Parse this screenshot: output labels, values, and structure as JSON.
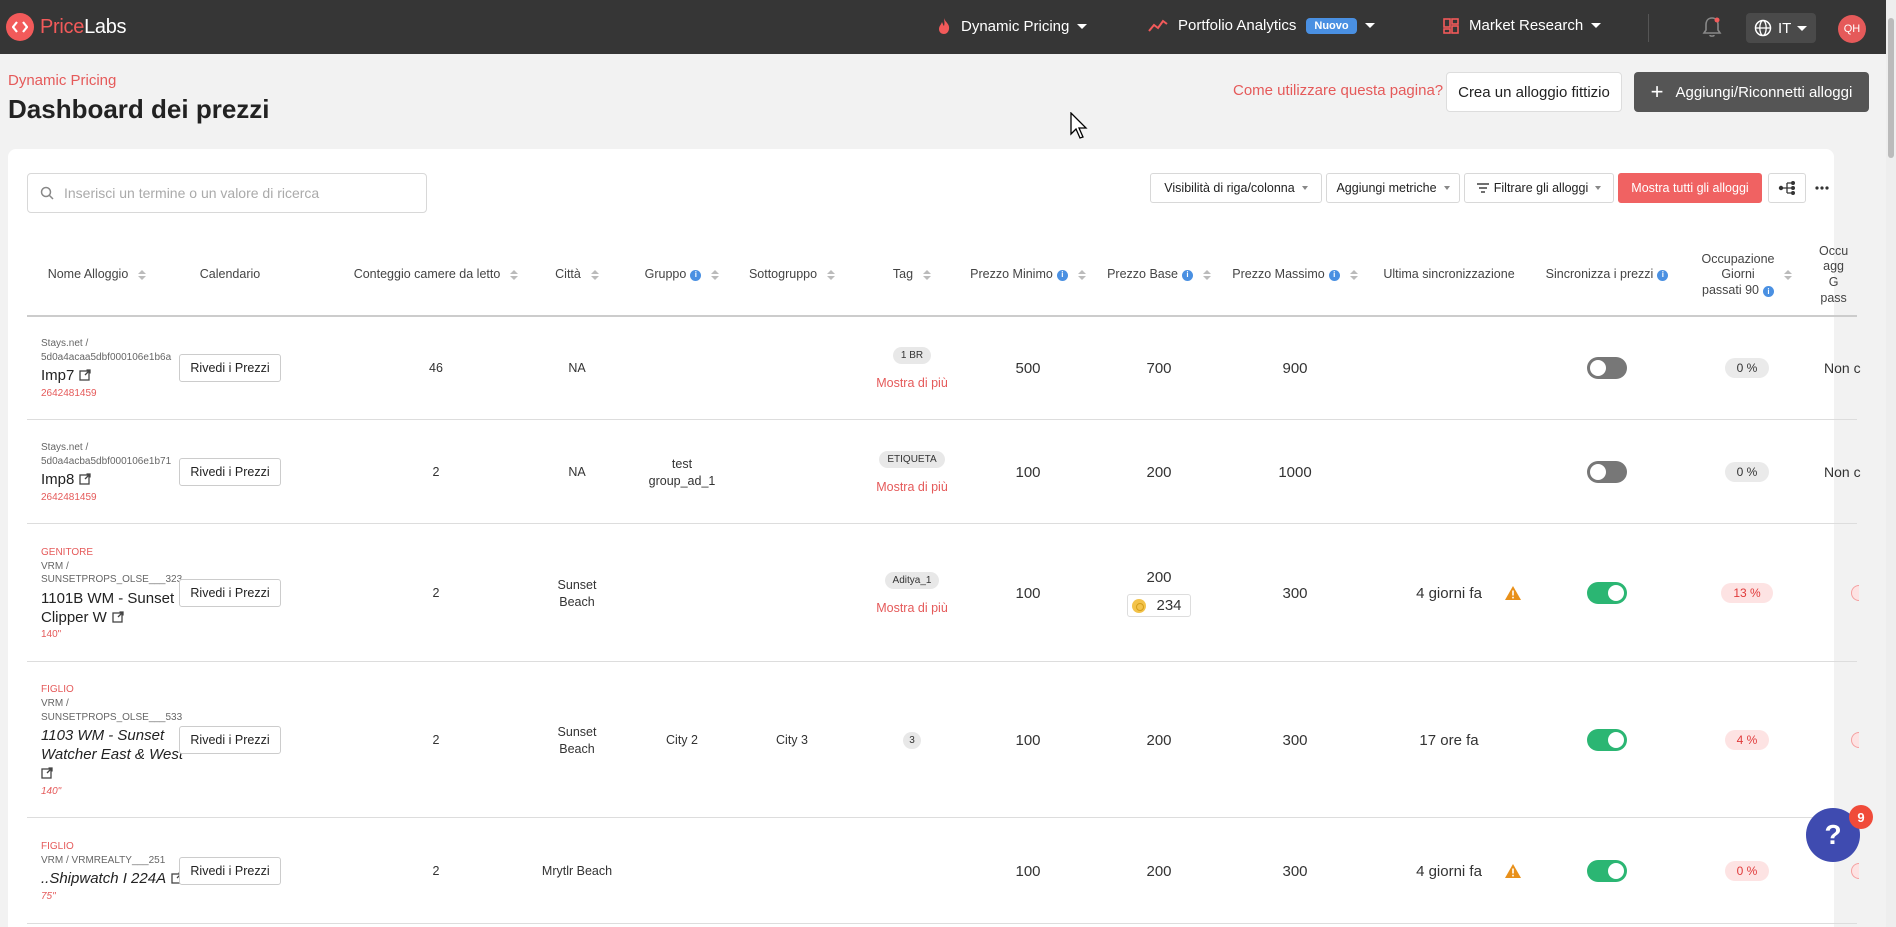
{
  "nav": {
    "logo_part1": "Price",
    "logo_part2": "Labs",
    "dynamic_pricing": "Dynamic Pricing",
    "portfolio_analytics": "Portfolio Analytics",
    "nuovo_badge": "Nuovo",
    "market_research": "Market Research",
    "language": "IT",
    "avatar_initials": "QH"
  },
  "header": {
    "breadcrumb": "Dynamic Pricing",
    "title": "Dashboard dei prezzi",
    "help_link": "Come utilizzare questa pagina?",
    "create_dummy_button": "Crea un alloggio fittizio",
    "add_reconnect_button": "Aggiungi/Riconnetti alloggi"
  },
  "toolbar": {
    "search_placeholder": "Inserisci un termine o un valore di ricerca",
    "visibility_button": "Visibilità di riga/colonna",
    "add_metrics_button": "Aggiungi metriche",
    "filter_button": "Filtrare gli alloggi",
    "show_all_button": "Mostra tutti gli alloggi"
  },
  "columns": {
    "name": "Nome Alloggio",
    "calendar": "Calendario",
    "bedrooms": "Conteggio camere da letto",
    "city": "Città",
    "group": "Gruppo",
    "subgroup": "Sottogruppo",
    "tag": "Tag",
    "min_price": "Prezzo Minimo",
    "base_price": "Prezzo Base",
    "max_price": "Prezzo Massimo",
    "last_sync": "Ultima sincronizzazione",
    "sync_prices": "Sincronizza i prezzi",
    "occupancy_l1": "Occupazione",
    "occupancy_l2": "Giorni",
    "occupancy_l3": "passati 90",
    "cut_l1": "Occu",
    "cut_l2": "agg",
    "cut_l3": "G",
    "cut_l4": "pass"
  },
  "common": {
    "review_button": "Rivedi i Prezzi",
    "show_more": "Mostra di più",
    "non_cut": "Non c"
  },
  "rows": [
    {
      "relation": "",
      "pms_line1": "Stays.net /",
      "pms_line2": "5d0a4acaa5dbf000106e1b6a",
      "name": "Imp7",
      "listing_id": "2642481459",
      "bedrooms": "46",
      "city": "NA",
      "group": "",
      "subgroup": "",
      "tag": "1 BR",
      "min_price": "500",
      "base_price": "700",
      "base_alt": "",
      "max_price": "900",
      "last_sync": "",
      "sync_on": false,
      "occupancy": "0 %"
    },
    {
      "relation": "",
      "pms_line1": "Stays.net /",
      "pms_line2": "5d0a4acba5dbf000106e1b71",
      "name": "Imp8",
      "listing_id": "2642481459",
      "bedrooms": "2",
      "city": "NA",
      "group_line1": "test",
      "group_line2": "group_ad_1",
      "subgroup": "",
      "tag": "ETIQUETA",
      "min_price": "100",
      "base_price": "200",
      "base_alt": "",
      "max_price": "1000",
      "last_sync": "",
      "sync_on": false,
      "occupancy": "0 %"
    },
    {
      "relation": "GENITORE",
      "pms_line1": "VRM /",
      "pms_line2": "SUNSETPROPS_OLSE___323",
      "name_line1": "1101B WM - Sunset",
      "name_line2": "Clipper W",
      "listing_id": "140\"",
      "bedrooms": "2",
      "city_line1": "Sunset",
      "city_line2": "Beach",
      "group": "",
      "subgroup": "",
      "tag": "Aditya_1",
      "min_price": "100",
      "base_price": "200",
      "base_alt": "234",
      "max_price": "300",
      "last_sync": "4 giorni fa",
      "sync_on": true,
      "occupancy": "13 %"
    },
    {
      "relation": "FIGLIO",
      "pms_line1": "VRM /",
      "pms_line2": "SUNSETPROPS_OLSE___533",
      "name_line1": "1103 WM - Sunset",
      "name_line2": "Watcher East & West",
      "listing_id": "140\"",
      "bedrooms": "2",
      "city_line1": "Sunset",
      "city_line2": "Beach",
      "group": "City 2",
      "subgroup": "City 3",
      "tag": "3",
      "min_price": "100",
      "base_price": "200",
      "base_alt": "",
      "max_price": "300",
      "last_sync": "17 ore fa",
      "sync_on": true,
      "occupancy": "4 %"
    },
    {
      "relation": "FIGLIO",
      "pms_line1": "VRM / VRMREALTY___251",
      "pms_line2": "",
      "name": "..Shipwatch I 224A",
      "listing_id": "75\"",
      "bedrooms": "2",
      "city": "Mrytlr Beach",
      "group": "",
      "subgroup": "",
      "tag": "",
      "min_price": "100",
      "base_price": "200",
      "base_alt": "",
      "max_price": "300",
      "last_sync": "4 giorni fa",
      "sync_on": true,
      "occupancy": "0 %"
    }
  ],
  "help_widget": {
    "count": "9",
    "symbol": "?"
  },
  "colors": {
    "accent": "#e55a5a",
    "nav_bg": "#363636",
    "toggle_on": "#2bb673",
    "info_blue": "#4a90e2"
  }
}
